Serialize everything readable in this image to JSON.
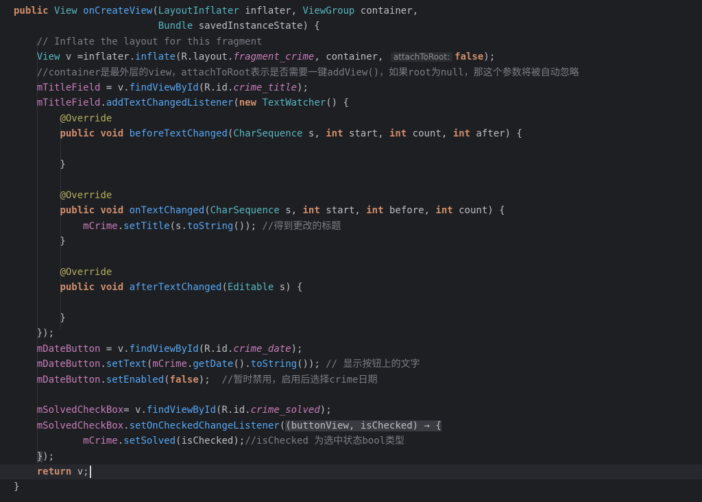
{
  "editor": {
    "language": "java",
    "colors": {
      "background": "#1e1f22",
      "current_line": "#26282e",
      "keyword": "#cf8e6d",
      "method": "#56a8f5",
      "type": "#56b6c2",
      "field": "#c77dbb",
      "annotation": "#b3ae60",
      "comment": "#7a7e85",
      "text": "#bcbec4"
    },
    "lines": [
      [
        {
          "t": "kw",
          "v": "public"
        },
        {
          "t": "plain",
          "v": " "
        },
        {
          "t": "cls",
          "v": "View"
        },
        {
          "t": "plain",
          "v": " "
        },
        {
          "t": "fn",
          "v": "onCreateView"
        },
        {
          "t": "plain",
          "v": "("
        },
        {
          "t": "cls",
          "v": "LayoutInflater"
        },
        {
          "t": "plain",
          "v": " inflater, "
        },
        {
          "t": "cls",
          "v": "ViewGroup"
        },
        {
          "t": "plain",
          "v": " container,"
        }
      ],
      [
        {
          "t": "plain",
          "v": "                         "
        },
        {
          "t": "cls",
          "v": "Bundle"
        },
        {
          "t": "plain",
          "v": " savedInstanceState) {"
        }
      ],
      [
        {
          "t": "plain",
          "v": "    "
        },
        {
          "t": "comment",
          "v": "// Inflate the layout for this fragment"
        }
      ],
      [
        {
          "t": "plain",
          "v": "    "
        },
        {
          "t": "cls",
          "v": "View"
        },
        {
          "t": "plain",
          "v": " v ="
        },
        {
          "t": "plain",
          "v": "inflater."
        },
        {
          "t": "fn",
          "v": "inflate"
        },
        {
          "t": "plain",
          "v": "(R.layout."
        },
        {
          "t": "italic",
          "v": "fragment_crime"
        },
        {
          "t": "plain",
          "v": ", container, "
        },
        {
          "t": "hint",
          "v": "attachToRoot:"
        },
        {
          "t": "lit",
          "v": "false"
        },
        {
          "t": "plain",
          "v": ");"
        }
      ],
      [
        {
          "t": "plain",
          "v": "    "
        },
        {
          "t": "comment",
          "v": "//container是最外层的view，attachToRoot表示是否需要一键addView()，如果root为null，那这个参数将被自动忽略"
        }
      ],
      [
        {
          "t": "plain",
          "v": "    "
        },
        {
          "t": "field",
          "v": "mTitleField"
        },
        {
          "t": "plain",
          "v": " = v."
        },
        {
          "t": "fn",
          "v": "findViewById"
        },
        {
          "t": "plain",
          "v": "(R.id."
        },
        {
          "t": "italic",
          "v": "crime_title"
        },
        {
          "t": "plain",
          "v": ");"
        }
      ],
      [
        {
          "t": "plain",
          "v": "    "
        },
        {
          "t": "field",
          "v": "mTitleField"
        },
        {
          "t": "plain",
          "v": "."
        },
        {
          "t": "fn",
          "v": "addTextChangedListener"
        },
        {
          "t": "plain",
          "v": "("
        },
        {
          "t": "kw",
          "v": "new"
        },
        {
          "t": "plain",
          "v": " "
        },
        {
          "t": "cls",
          "v": "TextWatcher"
        },
        {
          "t": "plain",
          "v": "() {"
        }
      ],
      [
        {
          "t": "plain",
          "v": "        "
        },
        {
          "t": "ann",
          "v": "@Override"
        }
      ],
      [
        {
          "t": "plain",
          "v": "        "
        },
        {
          "t": "kw",
          "v": "public"
        },
        {
          "t": "plain",
          "v": " "
        },
        {
          "t": "kw",
          "v": "void"
        },
        {
          "t": "plain",
          "v": " "
        },
        {
          "t": "fn",
          "v": "beforeTextChanged"
        },
        {
          "t": "plain",
          "v": "("
        },
        {
          "t": "cls",
          "v": "CharSequence"
        },
        {
          "t": "plain",
          "v": " s, "
        },
        {
          "t": "kw",
          "v": "int"
        },
        {
          "t": "plain",
          "v": " start, "
        },
        {
          "t": "kw",
          "v": "int"
        },
        {
          "t": "plain",
          "v": " count, "
        },
        {
          "t": "kw",
          "v": "int"
        },
        {
          "t": "plain",
          "v": " after) {"
        }
      ],
      [],
      [
        {
          "t": "plain",
          "v": "        }"
        }
      ],
      [],
      [
        {
          "t": "plain",
          "v": "        "
        },
        {
          "t": "ann",
          "v": "@Override"
        }
      ],
      [
        {
          "t": "plain",
          "v": "        "
        },
        {
          "t": "kw",
          "v": "public"
        },
        {
          "t": "plain",
          "v": " "
        },
        {
          "t": "kw",
          "v": "void"
        },
        {
          "t": "plain",
          "v": " "
        },
        {
          "t": "fn",
          "v": "onTextChanged"
        },
        {
          "t": "plain",
          "v": "("
        },
        {
          "t": "cls",
          "v": "CharSequence"
        },
        {
          "t": "plain",
          "v": " s, "
        },
        {
          "t": "kw",
          "v": "int"
        },
        {
          "t": "plain",
          "v": " start, "
        },
        {
          "t": "kw",
          "v": "int"
        },
        {
          "t": "plain",
          "v": " before, "
        },
        {
          "t": "kw",
          "v": "int"
        },
        {
          "t": "plain",
          "v": " count) {"
        }
      ],
      [
        {
          "t": "plain",
          "v": "            "
        },
        {
          "t": "field",
          "v": "mCrime"
        },
        {
          "t": "plain",
          "v": "."
        },
        {
          "t": "fn",
          "v": "setTitle"
        },
        {
          "t": "plain",
          "v": "(s."
        },
        {
          "t": "fn",
          "v": "toString"
        },
        {
          "t": "plain",
          "v": "()); "
        },
        {
          "t": "comment",
          "v": "//得到更改的标题"
        }
      ],
      [
        {
          "t": "plain",
          "v": "        }"
        }
      ],
      [],
      [
        {
          "t": "plain",
          "v": "        "
        },
        {
          "t": "ann",
          "v": "@Override"
        }
      ],
      [
        {
          "t": "plain",
          "v": "        "
        },
        {
          "t": "kw",
          "v": "public"
        },
        {
          "t": "plain",
          "v": " "
        },
        {
          "t": "kw",
          "v": "void"
        },
        {
          "t": "plain",
          "v": " "
        },
        {
          "t": "fn",
          "v": "afterTextChanged"
        },
        {
          "t": "plain",
          "v": "("
        },
        {
          "t": "cls",
          "v": "Editable"
        },
        {
          "t": "plain",
          "v": " s) {"
        }
      ],
      [],
      [
        {
          "t": "plain",
          "v": "        }"
        }
      ],
      [
        {
          "t": "plain",
          "v": "    });"
        }
      ],
      [
        {
          "t": "plain",
          "v": "    "
        },
        {
          "t": "field",
          "v": "mDateButton"
        },
        {
          "t": "plain",
          "v": " = v."
        },
        {
          "t": "fn",
          "v": "findViewById"
        },
        {
          "t": "plain",
          "v": "(R.id."
        },
        {
          "t": "italic",
          "v": "crime_date"
        },
        {
          "t": "plain",
          "v": ");"
        }
      ],
      [
        {
          "t": "plain",
          "v": "    "
        },
        {
          "t": "field",
          "v": "mDateButton"
        },
        {
          "t": "plain",
          "v": "."
        },
        {
          "t": "fn",
          "v": "setText"
        },
        {
          "t": "plain",
          "v": "("
        },
        {
          "t": "field",
          "v": "mCrime"
        },
        {
          "t": "plain",
          "v": "."
        },
        {
          "t": "fn",
          "v": "getDate"
        },
        {
          "t": "plain",
          "v": "()."
        },
        {
          "t": "fn",
          "v": "toString"
        },
        {
          "t": "plain",
          "v": "()); "
        },
        {
          "t": "comment",
          "v": "// 显示按钮上的文字"
        }
      ],
      [
        {
          "t": "plain",
          "v": "    "
        },
        {
          "t": "field",
          "v": "mDateButton"
        },
        {
          "t": "plain",
          "v": "."
        },
        {
          "t": "fn",
          "v": "setEnabled"
        },
        {
          "t": "plain",
          "v": "("
        },
        {
          "t": "lit",
          "v": "false"
        },
        {
          "t": "plain",
          "v": ");  "
        },
        {
          "t": "comment",
          "v": "//暂时禁用，启用后选择crime日期"
        }
      ],
      [],
      [
        {
          "t": "plain",
          "v": "    "
        },
        {
          "t": "field",
          "v": "mSolvedCheckBox"
        },
        {
          "t": "plain",
          "v": "= v."
        },
        {
          "t": "fn",
          "v": "findViewById"
        },
        {
          "t": "plain",
          "v": "(R.id."
        },
        {
          "t": "italic",
          "v": "crime_solved"
        },
        {
          "t": "plain",
          "v": ");"
        }
      ],
      [
        {
          "t": "plain",
          "v": "    "
        },
        {
          "t": "field",
          "v": "mSolvedCheckBox"
        },
        {
          "t": "plain",
          "v": "."
        },
        {
          "t": "fn",
          "v": "setOnCheckedChangeListener"
        },
        {
          "t": "plain",
          "v": "("
        },
        {
          "t": "lambda",
          "v": "(buttonView, isChecked) → {"
        }
      ],
      [
        {
          "t": "plain",
          "v": "            "
        },
        {
          "t": "field",
          "v": "mCrime"
        },
        {
          "t": "plain",
          "v": "."
        },
        {
          "t": "fn",
          "v": "setSolved"
        },
        {
          "t": "plain",
          "v": "(isChecked);"
        },
        {
          "t": "comment",
          "v": "//isChecked 为选中状态bool类型"
        }
      ],
      [
        {
          "t": "plain",
          "v": "    "
        },
        {
          "t": "hlbrace",
          "v": "}"
        },
        {
          "t": "plain",
          "v": ");"
        }
      ],
      [
        {
          "t": "plain",
          "v": "    "
        },
        {
          "t": "kw",
          "v": "return"
        },
        {
          "t": "plain",
          "v": " v;"
        },
        {
          "t": "caret",
          "v": ""
        }
      ],
      [
        {
          "t": "plain",
          "v": "}"
        }
      ]
    ],
    "current_line_index": 30
  }
}
